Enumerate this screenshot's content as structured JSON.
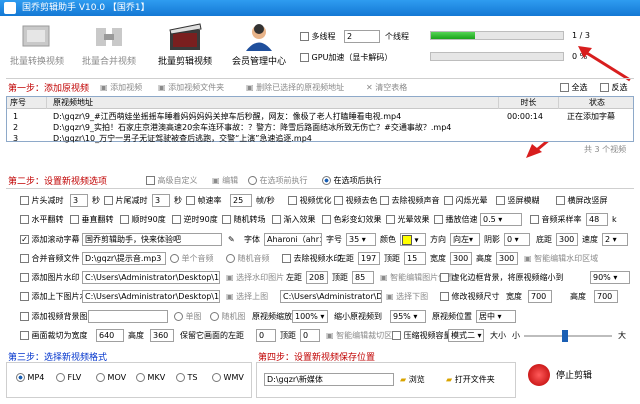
{
  "window": {
    "title": "国乔剪辑助手 V10.0 【国乔1】"
  },
  "toolbar": {
    "btn1": "批量转换视频",
    "btn2": "批量合并视频",
    "btn3": "批量剪辑视频",
    "btn4": "会员管理中心",
    "multithread": "多线程",
    "threads": "2",
    "threads_unit": "个线程",
    "gpu": "GPU加速（显卡解码）",
    "progress1": {
      "text": "1 / 3",
      "fraction": 0.33
    },
    "progress2": {
      "text": "0 %",
      "fraction": 0.0
    }
  },
  "step1": {
    "title": "第一步：添加原视频",
    "add_video": "添加视频",
    "add_folder": "添加视频文件夹",
    "delete_checked": "删除已选择的原视频地址",
    "clear": "清空表格",
    "select_all": "全选",
    "invert": "反选"
  },
  "table": {
    "headers": [
      "序号",
      "原视频地址",
      "时长",
      "状态"
    ],
    "rows": [
      {
        "no": "1",
        "path": "D:\\gqzr\\9_#江西萌娃坐摇摇车睡着妈妈妈妈关掉车后秒醒，网友：像极了老人打瞌睡看电视.mp4",
        "duration": "00:00:14",
        "status": "正在添加字幕"
      },
      {
        "no": "2",
        "path": "D:\\gqzr\\9_实拍！石家庄京港澳高速20余车连环事故：？警方：降雪后路面结冰所致无伤亡？#交通事故？.mp4",
        "duration": "",
        "status": ""
      },
      {
        "no": "3",
        "path": "D:\\gqzr\\10_万宁一男子无证驾驶被查后逃跑，交警“上演”急速追逐.mp4",
        "duration": "",
        "status": ""
      }
    ],
    "count": "共 3 个视频"
  },
  "step2": {
    "title": "第二步：设置新视频选项",
    "advanced": "高级自定义",
    "edit": "编辑",
    "run_selected": "在选项前执行",
    "run_after": "在选项后执行",
    "head_cut": "片头减时",
    "head_val": "3",
    "sec": "秒",
    "tail_cut": "片尾减时",
    "tail_val": "3",
    "sec2": "秒",
    "framerate": "帧速率",
    "fr_val": "25",
    "fps": "帧/秒",
    "optimize": "视频优化",
    "denoise": "视频去色",
    "remove_audio": "去除视频声音",
    "flash": "闪烁光晕",
    "portrait": "竖屏模糊",
    "crop": "横屏改竖屏",
    "hflip": "水平翻转",
    "vflip": "垂直翻转",
    "rot90cw": "顺时90度",
    "rot90ccw": "逆时90度",
    "random_pos": "随机转场",
    "fade": "渐入效果",
    "color_fx": "色彩变幻效果",
    "light_fx": "光晕效果",
    "speed": "播放倍速",
    "speed_val": "0.5",
    "audio_sample": "音频采样率",
    "sample_val": "48",
    "k": "k",
    "add_subtitle": "添加滚动字幕",
    "subtitle_text": "国乔剪辑助手，快来体验吧",
    "font": "字体",
    "font_val": "Aharoni（ahr：",
    "size": "字号",
    "size_val": "35",
    "color": "颜色",
    "direction": "方向",
    "dir_val": "向左",
    "shadow": "阴影",
    "shadow_val": "0",
    "margin": "底距",
    "margin_val": "300",
    "speed2": "速度",
    "speed2_val": "2",
    "merge_audio": "合并音频文件",
    "audio_path": "D:\\gqzr\\提示音.mp3",
    "single_audio": "单个音频",
    "random_audio": "随机音频",
    "remove_logo": "去除视频水印",
    "left": "左距",
    "left_val": "197",
    "top": "顶距",
    "top_val": "15",
    "width": "宽度",
    "width_val": "300",
    "height": "高度",
    "height_val": "300",
    "smart_edit": "智能编辑水印区域",
    "add_img_wm": "添加图片水印",
    "img_wm_path": "C:\\Users\\Administrator\\Desktop\\111.jpg",
    "select_wm": "选择水印图片",
    "left2": "左距",
    "left2_val": "208",
    "top2": "顶距",
    "top2_val": "85",
    "smart_wm": "智能编辑图片位置",
    "virtual_bg": "虚化边框背景，将原视频缩小到",
    "virtual_val": "90%",
    "add_frame": "添加上下图片水印",
    "frame_path": "C:\\Users\\Administrator\\Desktop\\11",
    "upper": "选择上图",
    "frame_path2": "C:\\Users\\Administrator\\Desk",
    "lower": "选择下图",
    "resize": "修改视频尺寸",
    "width2": "宽度",
    "width2_val": "700",
    "height2": "高度",
    "height2_val": "700",
    "add_bgimg": "添加视频背景图片",
    "single_img": "单图",
    "random_img": "随机图",
    "scale": "原视频缩放",
    "scale_val": "100%",
    "shrink": "缩小原视频到",
    "shrink_val": "95%",
    "pos": "原视频位置",
    "pos_val": "居中",
    "crop_area": "画面裁切为宽度",
    "crop_w": "640",
    "crop_h_label": "高度",
    "crop_h": "360",
    "keep_left": "保留它画面的左距",
    "keep_left_val": "0",
    "keep_top": "顶距",
    "keep_top_val": "0",
    "smart_crop": "智能编辑裁切区域",
    "compress": "压缩视频容量",
    "mode": "模式二",
    "size_small": "大小",
    "small": "小",
    "big": "大"
  },
  "step3": {
    "title": "第三步：选择新视频格式",
    "formats": [
      "MP4",
      "FLV",
      "MOV",
      "MKV",
      "TS",
      "WMV"
    ]
  },
  "step4": {
    "title": "第四步：设置新视频保存位置",
    "path": "D:\\gqzr\\新媒体",
    "browse": "浏览",
    "open_folder": "打开文件夹",
    "stop": "停止剪辑"
  },
  "colors": {
    "title_bar": "#1478d4",
    "section_red": "#c00000",
    "section_blue": "#0033cc",
    "progress": "#1aa31a",
    "arrow": "#d81e1e"
  }
}
